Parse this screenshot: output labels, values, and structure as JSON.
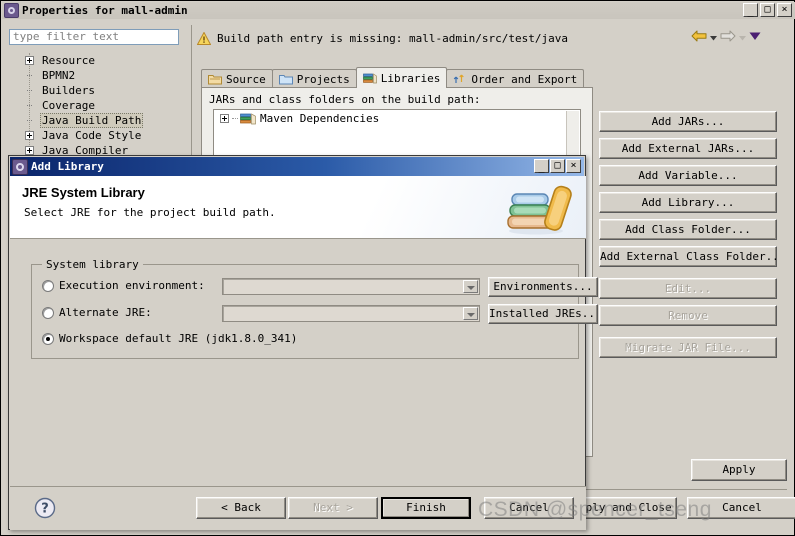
{
  "properties_window": {
    "title": "Properties for mall-admin",
    "title_icon": "gear-icon",
    "window_buttons": {
      "minimize": "_",
      "maximize": "□",
      "close": "×"
    },
    "filter": {
      "placeholder": "type filter text",
      "value": ""
    },
    "tree": {
      "items": [
        {
          "label": "Resource",
          "expandable": true,
          "selected": false
        },
        {
          "label": "BPMN2",
          "expandable": false,
          "selected": false
        },
        {
          "label": "Builders",
          "expandable": false,
          "selected": false
        },
        {
          "label": "Coverage",
          "expandable": false,
          "selected": false
        },
        {
          "label": "Java Build Path",
          "expandable": false,
          "selected": true
        },
        {
          "label": "Java Code Style",
          "expandable": true,
          "selected": false
        },
        {
          "label": "Java Compiler",
          "expandable": true,
          "selected": false
        }
      ]
    },
    "warning": {
      "icon": "warning-triangle-icon",
      "text": "Build path entry is missing: mall-admin/src/test/java"
    },
    "navigation": {
      "back_icon": "back-arrow-icon",
      "back_menu_icon": "chevron-down-icon",
      "forward_icon": "forward-arrow-icon",
      "forward_menu_icon": "chevron-down-icon",
      "view_menu_icon": "menu-triangle-icon"
    },
    "tabs": [
      {
        "label": "Source",
        "icon": "source-folder-icon",
        "active": false
      },
      {
        "label": "Projects",
        "icon": "projects-folder-icon",
        "active": false
      },
      {
        "label": "Libraries",
        "icon": "libraries-books-icon",
        "active": true
      },
      {
        "label": "Order and Export",
        "icon": "order-export-icon",
        "active": false
      }
    ],
    "libraries_panel": {
      "description": "JARs and class folders on the build path:",
      "entries": [
        {
          "label": "Maven Dependencies",
          "icon": "libraries-books-icon",
          "expandable": true
        }
      ]
    },
    "side_buttons": [
      {
        "label": "Add JARs...",
        "enabled": true
      },
      {
        "label": "Add External JARs...",
        "enabled": true
      },
      {
        "label": "Add Variable...",
        "enabled": true
      },
      {
        "label": "Add Library...",
        "enabled": true
      },
      {
        "label": "Add Class Folder...",
        "enabled": true
      },
      {
        "label": "Add External Class Folder...",
        "enabled": true
      },
      {
        "label": "Edit...",
        "enabled": false
      },
      {
        "label": "Remove",
        "enabled": false
      },
      {
        "label": "Migrate JAR File...",
        "enabled": false
      }
    ],
    "apply_label": "Apply",
    "footer_buttons": [
      {
        "label": "Apply and Close",
        "enabled": true
      },
      {
        "label": "Cancel",
        "enabled": true
      }
    ]
  },
  "add_library_dialog": {
    "title": "Add Library",
    "title_icon": "gear-icon",
    "window_buttons": {
      "minimize": "_",
      "maximize": "□",
      "close": "×"
    },
    "heading": "JRE System Library",
    "subheading": "Select JRE for the project build path.",
    "banner_icon": "books-stack-icon",
    "group": {
      "title": "System library",
      "options": [
        {
          "label": "Execution environment:",
          "selected": false,
          "has_combo": true,
          "combo_value": "",
          "button": {
            "label": "Environments...",
            "enabled": true
          }
        },
        {
          "label": "Alternate JRE:",
          "selected": false,
          "has_combo": true,
          "combo_value": "",
          "button": {
            "label": "Installed JREs...",
            "enabled": true
          }
        },
        {
          "label": "Workspace default JRE  (jdk1.8.0_341)",
          "selected": true,
          "has_combo": false,
          "combo_value": "",
          "button": null
        }
      ]
    },
    "help_icon": "help-question-icon",
    "buttons": [
      {
        "label": "< Back",
        "enabled": true,
        "default": false
      },
      {
        "label": "Next >",
        "enabled": false,
        "default": false
      },
      {
        "label": "Finish",
        "enabled": true,
        "default": true
      },
      {
        "label": "Cancel",
        "enabled": true,
        "default": false
      }
    ]
  },
  "watermark": {
    "text": "CSDN @spencer_tseng"
  }
}
